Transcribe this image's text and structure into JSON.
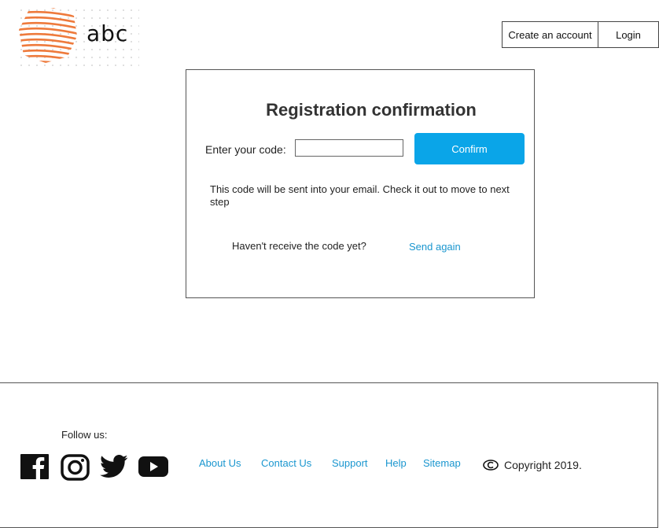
{
  "brand": {
    "name": "abc",
    "logo_icon": "striped-hexagon-logo",
    "accent": "#ee7a3c"
  },
  "topnav": {
    "create_account": "Create an account",
    "login": "Login"
  },
  "card": {
    "title": "Registration confirmation",
    "code_label": "Enter your code:",
    "code_value": "",
    "confirm_label": "Confirm",
    "confirm_color": "#0aa5e8",
    "info": "This code will be sent into your email. Check it out to move to next step",
    "resend_question": "Haven't receive the code yet?",
    "resend_link": "Send again"
  },
  "footer": {
    "follow_label": "Follow us:",
    "social": [
      "facebook-icon",
      "instagram-icon",
      "twitter-icon",
      "youtube-icon"
    ],
    "links": {
      "about": "About Us",
      "contact": "Contact Us",
      "support": "Support",
      "help": "Help",
      "sitemap": "Sitemap"
    },
    "link_color": "#1a96cf",
    "copyright": "Copyright 2019."
  }
}
